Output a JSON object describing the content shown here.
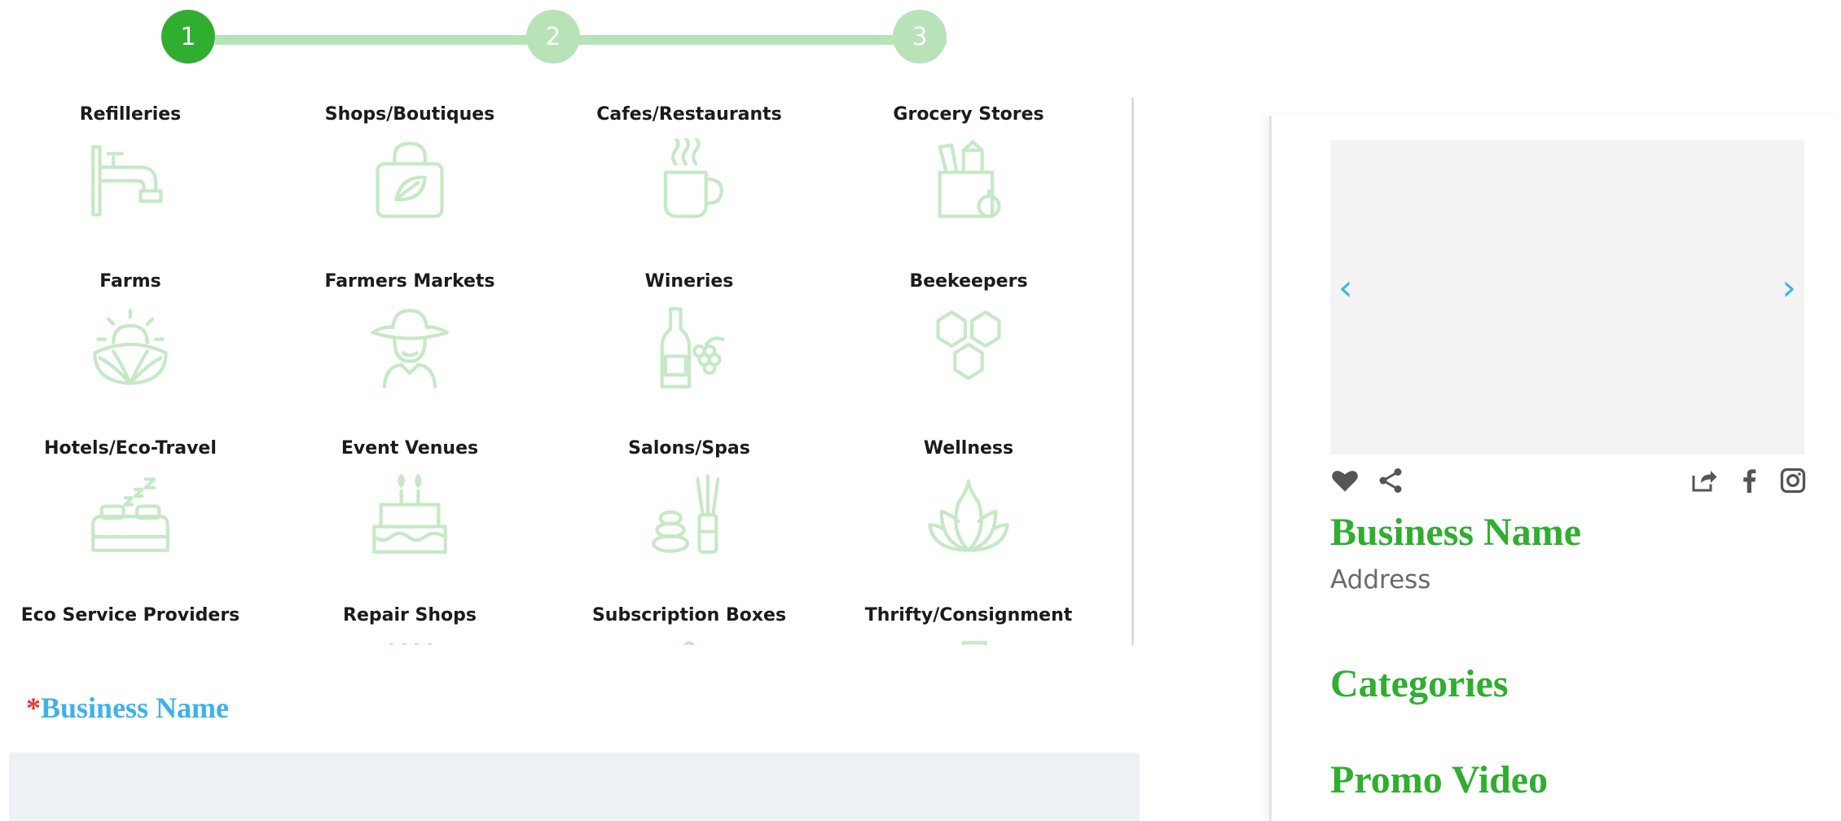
{
  "stepper": {
    "steps": [
      {
        "label": "1",
        "state": "active"
      },
      {
        "label": "2",
        "state": "inactive"
      },
      {
        "label": "3",
        "state": "inactive"
      }
    ],
    "colors": {
      "active": "#2fae2f",
      "inactive": "#b8e3b8"
    }
  },
  "categories": [
    {
      "label": "Refilleries",
      "icon": "faucet-icon"
    },
    {
      "label": "Shops/Boutiques",
      "icon": "shopping-bag-leaf-icon"
    },
    {
      "label": "Cafes/Restaurants",
      "icon": "coffee-cup-icon"
    },
    {
      "label": "Grocery Stores",
      "icon": "grocery-bag-icon"
    },
    {
      "label": "Farms",
      "icon": "farm-sun-icon"
    },
    {
      "label": "Farmers Markets",
      "icon": "farmer-icon"
    },
    {
      "label": "Wineries",
      "icon": "wine-bottle-icon"
    },
    {
      "label": "Beekeepers",
      "icon": "honeycomb-icon"
    },
    {
      "label": "Hotels/Eco-Travel",
      "icon": "bed-icon"
    },
    {
      "label": "Event Venues",
      "icon": "cake-icon"
    },
    {
      "label": "Salons/Spas",
      "icon": "spa-stones-icon"
    },
    {
      "label": "Wellness",
      "icon": "lotus-icon"
    },
    {
      "label": "Eco Service Providers",
      "icon": "eco-service-icon"
    },
    {
      "label": "Repair Shops",
      "icon": "repair-icon"
    },
    {
      "label": "Subscription Boxes",
      "icon": "box-icon"
    },
    {
      "label": "Thrifty/Consignment",
      "icon": "tag-icon"
    }
  ],
  "icon_color": "#c5e9c5",
  "form": {
    "required_marker": "*",
    "business_name_label": "Business Name",
    "business_name_value": ""
  },
  "preview": {
    "carousel_prev": "‹",
    "carousel_next": "›",
    "business_name": "Business Name",
    "address": "Address",
    "categories_heading": "Categories",
    "promo_video_heading": "Promo Video",
    "action_icons_left": [
      "heart-icon",
      "share-icon"
    ],
    "action_icons_right": [
      "external-share-icon",
      "facebook-icon",
      "instagram-icon"
    ],
    "accent_color": "#2fae2f",
    "link_color": "#3fb6e3"
  }
}
